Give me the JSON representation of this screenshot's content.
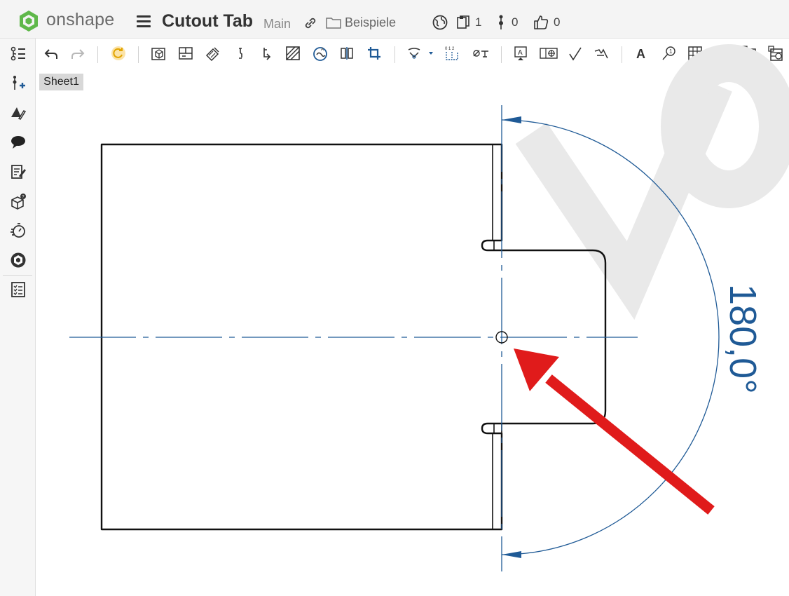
{
  "app": {
    "brand": "onshape",
    "document_title": "Cutout Tab",
    "branch": "Main",
    "folder": "Beispiele",
    "versions_count": "1",
    "branches_count": "0",
    "likes_count": "0"
  },
  "sheet": {
    "tab_label": "Sheet1"
  },
  "drawing": {
    "angle_dimension": "180,0°",
    "watermark": "VO"
  },
  "colors": {
    "dimension_blue": "#1f5a96",
    "arrow_red": "#e01b1b",
    "brand_green": "#4caf50"
  },
  "toolbar_icons": [
    "undo-icon",
    "redo-icon",
    "regenerate-icon",
    "insert-view-icon",
    "projected-view-icon",
    "section-view-icon",
    "detail-view-icon",
    "crop-view-icon",
    "auxiliary-view-icon",
    "hatch-icon",
    "break-view-icon",
    "broken-out-section-icon",
    "crop-icon",
    "centerline-icon",
    "ordinate-dimension-icon",
    "hole-callout-icon",
    "datum-icon",
    "feature-control-frame-icon",
    "surface-finish-icon",
    "weld-symbol-icon",
    "note-icon",
    "balloon-icon",
    "table-icon",
    "bom-table-icon",
    "hole-table-icon",
    "revision-table-icon"
  ],
  "left_icons": [
    "feature-list-icon",
    "insert-icon",
    "appearance-icon",
    "comments-icon",
    "notes-icon",
    "configurations-icon",
    "history-icon",
    "onshape-app-icon",
    "checklist-icon"
  ]
}
